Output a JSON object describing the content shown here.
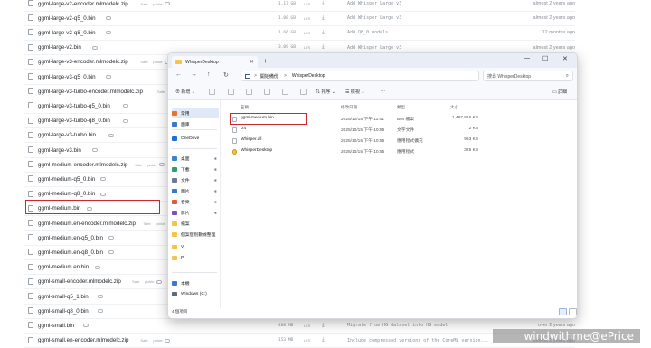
{
  "hf_files": [
    {
      "name": "ggml-large-v2-encoder.mlmodelc.zip",
      "tags": [
        "Safe",
        "pickle"
      ],
      "size": "1.17 GB",
      "lfs": "LFS",
      "commit": "Add Whisper Large v3",
      "ago": "almost 2 years ago"
    },
    {
      "name": "ggml-large-v2-q5_0.bin",
      "tags": [],
      "size": "1.08 GB",
      "lfs": "LFS",
      "commit": "Add Whisper Large v3",
      "ago": "almost 2 years ago"
    },
    {
      "name": "ggml-large-v2-q8_0.bin",
      "tags": [],
      "size": "1.66 GB",
      "lfs": "LFS",
      "commit": "Add Q8_0 models",
      "ago": "12 months ago"
    },
    {
      "name": "ggml-large-v2.bin",
      "tags": [],
      "size": "3.09 GB",
      "lfs": "LFS",
      "commit": "Add Whisper Large v3",
      "ago": "almost 2 years ago"
    },
    {
      "name": "ggml-large-v3-encoder.mlmodelc.zip",
      "tags": [
        "Safe",
        "pickle"
      ],
      "size": "",
      "lfs": "",
      "commit": "",
      "ago": ""
    },
    {
      "name": "ggml-large-v3-q5_0.bin",
      "tags": [],
      "size": "",
      "lfs": "",
      "commit": "",
      "ago": ""
    },
    {
      "name": "ggml-large-v3-turbo-encoder.mlmodelc.zip",
      "tags": [
        "Safe"
      ],
      "size": "",
      "lfs": "",
      "commit": "",
      "ago": ""
    },
    {
      "name": "ggml-large-v3-turbo-q5_0.bin",
      "tags": [],
      "size": "",
      "lfs": "",
      "commit": "",
      "ago": ""
    },
    {
      "name": "ggml-large-v3-turbo-q8_0.bin",
      "tags": [],
      "size": "",
      "lfs": "",
      "commit": "",
      "ago": ""
    },
    {
      "name": "ggml-large-v3-turbo.bin",
      "tags": [],
      "size": "",
      "lfs": "",
      "commit": "",
      "ago": ""
    },
    {
      "name": "ggml-large-v3.bin",
      "tags": [],
      "size": "",
      "lfs": "",
      "commit": "",
      "ago": ""
    },
    {
      "name": "ggml-medium-encoder.mlmodelc.zip",
      "tags": [
        "Safe",
        "pickle"
      ],
      "size": "",
      "lfs": "",
      "commit": "",
      "ago": ""
    },
    {
      "name": "ggml-medium-q5_0.bin",
      "tags": [],
      "size": "",
      "lfs": "",
      "commit": "",
      "ago": ""
    },
    {
      "name": "ggml-medium-q8_0.bin",
      "tags": [],
      "size": "",
      "lfs": "",
      "commit": "",
      "ago": ""
    },
    {
      "name": "ggml-medium.bin",
      "tags": [],
      "size": "",
      "lfs": "",
      "commit": "",
      "ago": ""
    },
    {
      "name": "ggml-medium.en-encoder.mlmodelc.zip",
      "tags": [
        "Safe",
        "pickle"
      ],
      "size": "",
      "lfs": "",
      "commit": "",
      "ago": ""
    },
    {
      "name": "ggml-medium.en-q5_0.bin",
      "tags": [],
      "size": "",
      "lfs": "",
      "commit": "",
      "ago": ""
    },
    {
      "name": "ggml-medium.en-q8_0.bin",
      "tags": [],
      "size": "",
      "lfs": "",
      "commit": "",
      "ago": ""
    },
    {
      "name": "ggml-medium.en.bin",
      "tags": [],
      "size": "",
      "lfs": "",
      "commit": "",
      "ago": ""
    },
    {
      "name": "ggml-small-encoder.mlmodelc.zip",
      "tags": [
        "Safe",
        "pickle"
      ],
      "size": "",
      "lfs": "",
      "commit": "",
      "ago": ""
    },
    {
      "name": "ggml-small-q5_1.bin",
      "tags": [],
      "size": "",
      "lfs": "",
      "commit": "",
      "ago": ""
    },
    {
      "name": "ggml-small-q8_0.bin",
      "tags": [],
      "size": "",
      "lfs": "",
      "commit": "",
      "ago": ""
    },
    {
      "name": "ggml-small.bin",
      "tags": [],
      "size": "488 MB",
      "lfs": "LFS",
      "commit": "Migrate from HG dataset into HG model",
      "ago": "over 2 years ago"
    },
    {
      "name": "ggml-small.en-encoder.mlmodelc.zip",
      "tags": [
        "Safe",
        "pickle"
      ],
      "size": "153 MB",
      "lfs": "LFS",
      "commit": "Include compressed versions of the CoreML version...",
      "ago": "almost 2 years ago"
    }
  ],
  "explorer": {
    "tab_title": "WhisperDesktop",
    "tab_close": "✕",
    "new_tab": "+",
    "win_min": "—",
    "win_max": "☐",
    "win_close": "✕",
    "nav_back": "←",
    "nav_forward": "→",
    "nav_up": "↑",
    "nav_refresh": "↻",
    "addr_root": "開始備份",
    "addr_sep1": ">",
    "addr_sep2": ">",
    "addr_folder": "WhisperDesktop",
    "search_placeholder": "搜尋 WhisperDesktop",
    "search_icon": "⌕",
    "toolbar": {
      "new_label": "新增",
      "sort_label": "排序",
      "view_label": "檢視",
      "more_label": "···",
      "details_label": "詳細"
    },
    "sidebar": [
      {
        "label": "常用",
        "icon": "home-icon",
        "color": "#e8742c"
      },
      {
        "label": "圖庫",
        "icon": "gallery-icon",
        "color": "#3a79c9"
      },
      {
        "label": "OneDrive",
        "icon": "cloud-icon",
        "color": "#1e6fd9"
      },
      {
        "label": "桌面",
        "icon": "desktop-icon",
        "color": "#3b82d6"
      },
      {
        "label": "下載",
        "icon": "download-icon",
        "color": "#2f9e6a"
      },
      {
        "label": "文件",
        "icon": "documents-icon",
        "color": "#6b7b8f"
      },
      {
        "label": "圖片",
        "icon": "pictures-icon",
        "color": "#3a79c9"
      },
      {
        "label": "音樂",
        "icon": "music-icon",
        "color": "#e25a3c"
      },
      {
        "label": "影片",
        "icon": "videos-icon",
        "color": "#7a4fc9"
      },
      {
        "label": "檔案",
        "icon": "folder-icon",
        "color": "#f4c54a"
      },
      {
        "label": "個案個別數據整理",
        "icon": "folder-icon",
        "color": "#f4c54a"
      },
      {
        "label": "V",
        "icon": "folder-icon",
        "color": "#f4c54a"
      },
      {
        "label": "P",
        "icon": "folder-icon",
        "color": "#f4c54a"
      },
      {
        "label": "本機",
        "icon": "pc-icon",
        "color": "#3a79c9"
      },
      {
        "label": "Windows (C:)",
        "icon": "drive-icon",
        "color": "#5a6a80"
      }
    ],
    "columns": {
      "name": "名稱",
      "date": "修改日期",
      "type": "類型",
      "size": "大小"
    },
    "files": [
      {
        "name": "ggml-medium.bin",
        "date": "2025/10/15 下午 11:01",
        "type": "BIN 檔案",
        "size": "1,497,816 KB",
        "icon": "file-icon"
      },
      {
        "name": "lz4",
        "date": "2025/10/15 下午 10:55",
        "type": "文字文件",
        "size": "2 KB",
        "icon": "file-icon"
      },
      {
        "name": "Whisper.dll",
        "date": "2025/10/15 下午 10:55",
        "type": "應用程式擴充",
        "size": "963 KB",
        "icon": "dll-icon"
      },
      {
        "name": "WhisperDesktop",
        "date": "2025/10/15 下午 10:55",
        "type": "應用程式",
        "size": "325 KB",
        "icon": "app-icon"
      }
    ],
    "status_text": "4 個項目"
  },
  "watermark": "windwithme@ePrice",
  "colors": {
    "highlight": "#d0262d",
    "accent": "#1e6fd9"
  }
}
